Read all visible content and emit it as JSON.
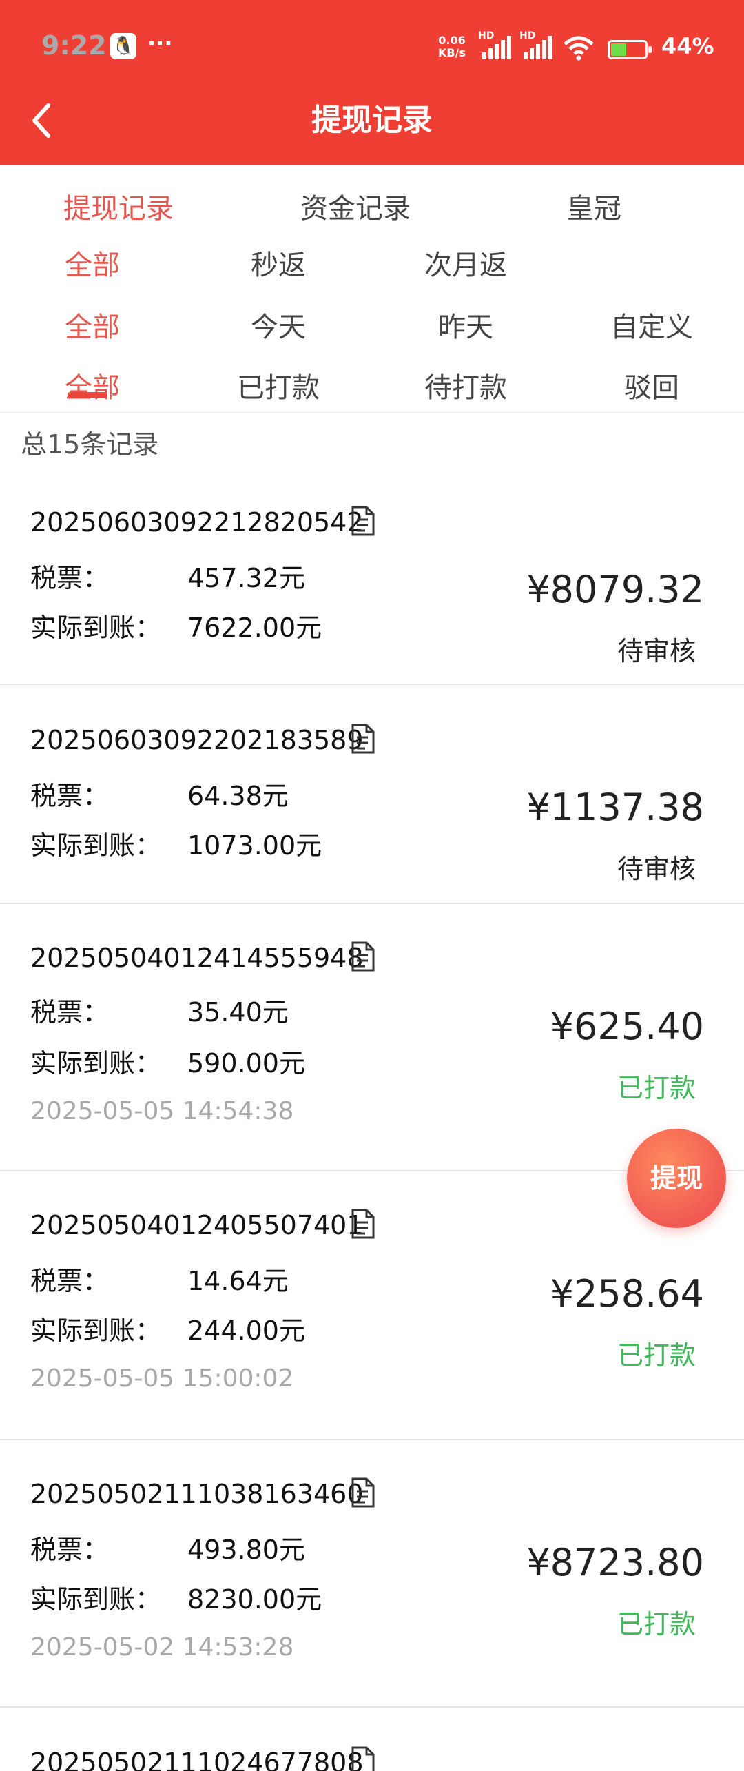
{
  "status_bar": {
    "time": "9:22",
    "dots": "···",
    "speed_value": "0.06",
    "speed_unit": "KB/s",
    "hd1": "HD",
    "hd2": "HD",
    "battery": "44%"
  },
  "header": {
    "title": "提现记录",
    "color": "#ef3e33"
  },
  "tabs_main": [
    "提现记录",
    "资金记录",
    "皇冠"
  ],
  "filter_type": [
    "全部",
    "秒返",
    "次月返"
  ],
  "filter_date": [
    "全部",
    "今天",
    "昨天",
    "自定义"
  ],
  "filter_status": [
    "全部",
    "已打款",
    "待打款",
    "驳回"
  ],
  "summary": "总15条记录",
  "labels": {
    "tax": "税票：",
    "actual": "实际到账："
  },
  "records": [
    {
      "id": "2025060309221282054​2",
      "tax": "457.32元",
      "actual": "7622.00元",
      "amount": "¥8079.32",
      "status": "待审核",
      "time": ""
    },
    {
      "id": "20250603092202183589",
      "tax": "64.38元",
      "actual": "1073.00元",
      "amount": "¥1137.38",
      "status": "待审核",
      "time": ""
    },
    {
      "id": "20250504012414555948",
      "tax": "35.40元",
      "actual": "590.00元",
      "amount": "¥625.40",
      "status": "已打款",
      "time": "2025-05-05 14:54:38"
    },
    {
      "id": "20250504012405507401",
      "tax": "14.64元",
      "actual": "244.00元",
      "amount": "¥258.64",
      "status": "已打款",
      "time": "2025-05-05 15:00:02"
    },
    {
      "id": "20250502111038163460",
      "tax": "493.80元",
      "actual": "8230.00元",
      "amount": "¥8723.80",
      "status": "已打款",
      "time": "2025-05-02 14:53:28"
    },
    {
      "id": "20250502111024677808"
    }
  ],
  "fab_label": "提现"
}
